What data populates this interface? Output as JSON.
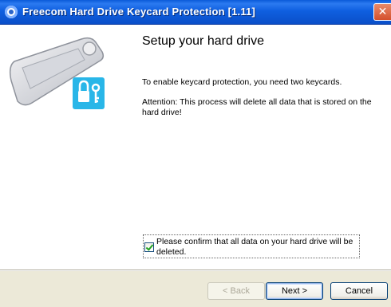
{
  "window": {
    "title": "Freecom Hard Drive Keycard Protection [1.11]",
    "close_label": "✕"
  },
  "page": {
    "heading": "Setup your hard drive",
    "intro": "To enable keycard protection, you need two keycards.",
    "warning": "Attention: This process will delete all data that is stored on the hard drive!"
  },
  "confirm": {
    "label": "Please confirm that all data on your hard drive will be deleted.",
    "checked": true
  },
  "buttons": {
    "back": "< Back",
    "next": "Next >",
    "cancel": "Cancel"
  },
  "colors": {
    "titlebar": "#0a5ad8",
    "accent_lock": "#29b6e8",
    "checkmark": "#21a121"
  },
  "icons": {
    "app": "freecom-app-icon",
    "illustration": "keycard-lock-icon"
  }
}
